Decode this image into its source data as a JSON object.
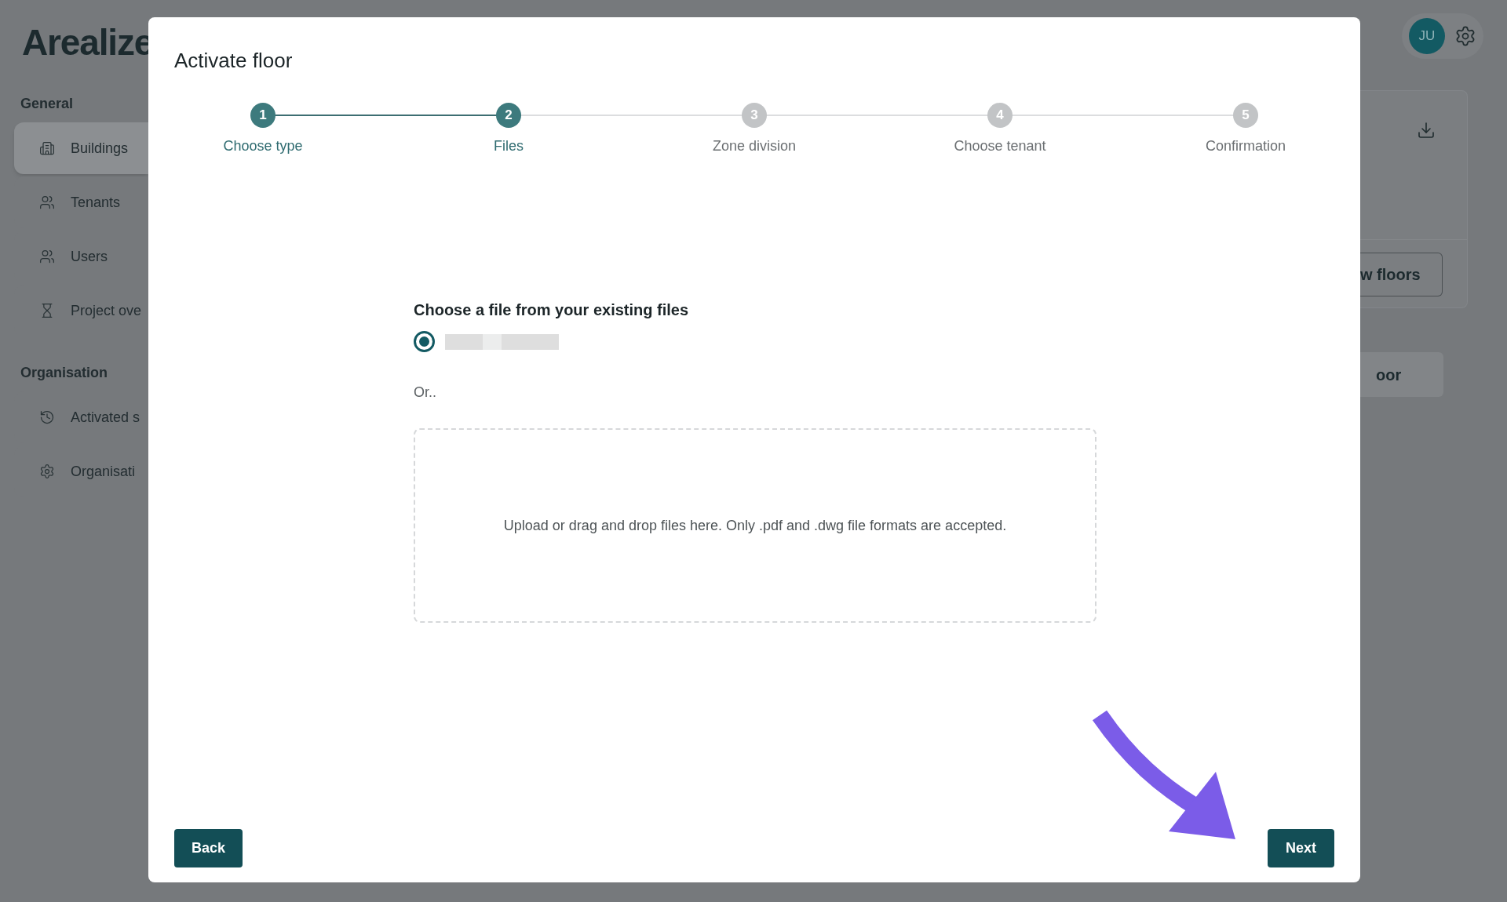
{
  "app": {
    "logo": "Arealize"
  },
  "sidebar": {
    "sections": [
      {
        "title": "General",
        "items": [
          {
            "label": "Buildings",
            "selected": true
          },
          {
            "label": "Tenants",
            "selected": false
          },
          {
            "label": "Users",
            "selected": false
          },
          {
            "label": "Project ove",
            "selected": false
          }
        ]
      },
      {
        "title": "Organisation",
        "items": [
          {
            "label": "Activated s",
            "selected": false
          },
          {
            "label": "Organisati",
            "selected": false
          }
        ]
      }
    ]
  },
  "header": {
    "avatar": "JU"
  },
  "background_card": {
    "button": "w floors",
    "second_button": "oor"
  },
  "dialog": {
    "title": "Activate floor",
    "steps": [
      {
        "number": "1",
        "label": "Choose type",
        "active": true
      },
      {
        "number": "2",
        "label": "Files",
        "active": true
      },
      {
        "number": "3",
        "label": "Zone division",
        "active": false
      },
      {
        "number": "4",
        "label": "Choose tenant",
        "active": false
      },
      {
        "number": "5",
        "label": "Confirmation",
        "active": false
      }
    ],
    "existing_files": {
      "heading": "Choose a file from your existing files",
      "files": [
        {
          "selected": true
        }
      ]
    },
    "or_label": "Or..",
    "dropzone": "Upload or drag and drop files here. Only .pdf and .dwg file formats are accepted.",
    "back_button": "Back",
    "next_button": "Next"
  }
}
